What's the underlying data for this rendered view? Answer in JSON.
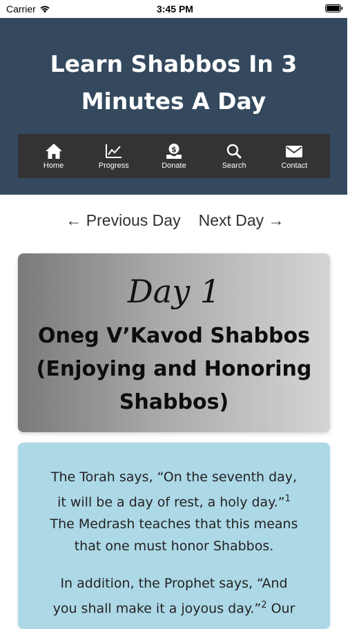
{
  "status_bar": {
    "carrier": "Carrier",
    "time": "3:45 PM"
  },
  "header": {
    "title_line1": "Learn Shabbos In 3",
    "title_line2": "Minutes A Day",
    "background_color": "#34495e"
  },
  "nav": {
    "items": [
      {
        "label": "Home",
        "icon": "home-icon"
      },
      {
        "label": "Progress",
        "icon": "chart-line-icon"
      },
      {
        "label": "Donate",
        "icon": "donate-hand-icon"
      },
      {
        "label": "Search",
        "icon": "search-icon"
      },
      {
        "label": "Contact",
        "icon": "envelope-icon"
      }
    ]
  },
  "day_nav": {
    "previous": "← Previous Day",
    "next": "Next Day →"
  },
  "day_card": {
    "day_label": "Day 1",
    "heading_line1": "Oneg V’Kavod Shabbos",
    "heading_line2": "(Enjoying and Honoring",
    "heading_line3": "Shabbos)"
  },
  "content": {
    "p1_line1": "The Torah says, “On the seventh day,",
    "p1_line2": "it will be a day of rest, a holy day.”",
    "p1_ref": "1",
    "p1_line3": "The Medrash teaches that this means",
    "p1_line4": "that one must honor Shabbos.",
    "p2_line1": "In addition, the Prophet says, “And",
    "p2_line2a": "you shall make it a joyous day.”",
    "p2_ref": "2",
    "p2_line2b": " Our",
    "background_color": "#add8e6"
  }
}
